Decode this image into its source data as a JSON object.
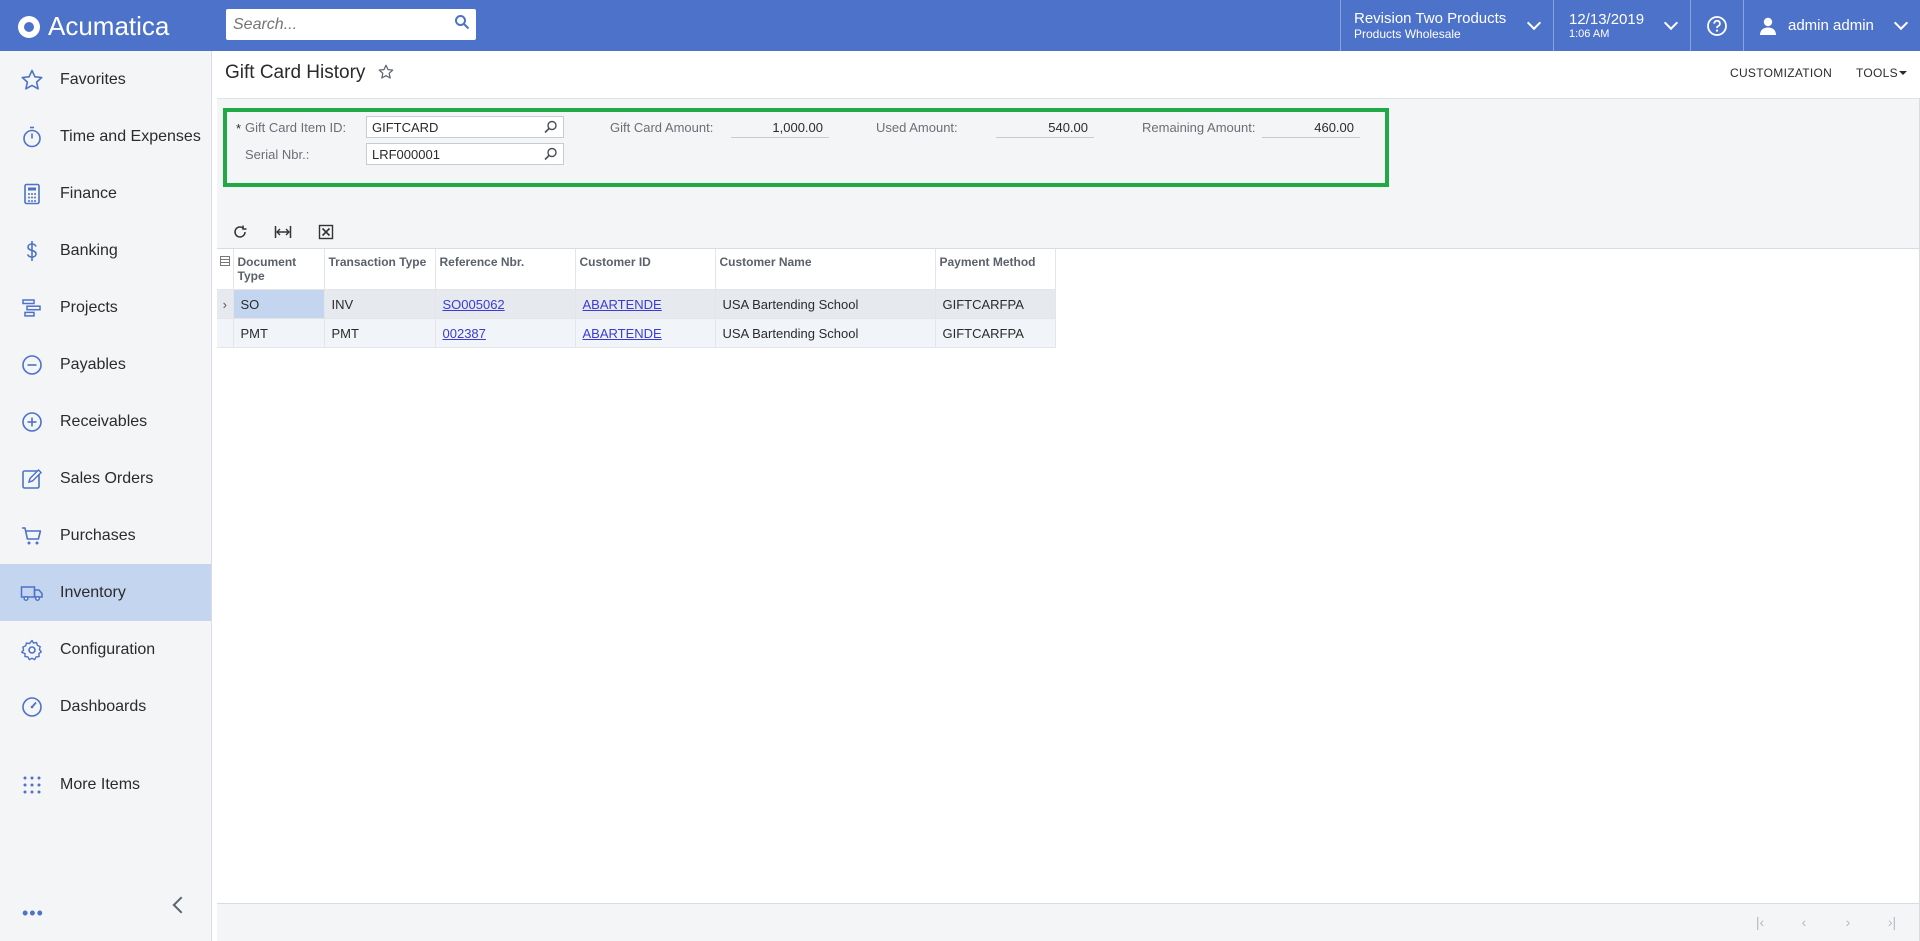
{
  "app": {
    "name": "Acumatica"
  },
  "search": {
    "placeholder": "Search..."
  },
  "header": {
    "company_line1": "Revision Two Products",
    "company_line2": "Products Wholesale",
    "date": "12/13/2019",
    "time": "1:06 AM",
    "user": "admin admin"
  },
  "sidebar": {
    "items": [
      {
        "label": "Favorites",
        "icon": "star-icon"
      },
      {
        "label": "Time and Expenses",
        "icon": "stopwatch-icon"
      },
      {
        "label": "Finance",
        "icon": "calculator-icon"
      },
      {
        "label": "Banking",
        "icon": "dollar-icon"
      },
      {
        "label": "Projects",
        "icon": "projects-icon"
      },
      {
        "label": "Payables",
        "icon": "minus-circle-icon"
      },
      {
        "label": "Receivables",
        "icon": "plus-circle-icon"
      },
      {
        "label": "Sales Orders",
        "icon": "edit-icon"
      },
      {
        "label": "Purchases",
        "icon": "cart-icon"
      },
      {
        "label": "Inventory",
        "icon": "truck-icon"
      },
      {
        "label": "Configuration",
        "icon": "gear-icon"
      },
      {
        "label": "Dashboards",
        "icon": "gauge-icon"
      },
      {
        "label": "More Items",
        "icon": "grid-dots-icon"
      }
    ],
    "active": "Inventory"
  },
  "page": {
    "title": "Gift Card History",
    "customization": "CUSTOMIZATION",
    "tools": "TOOLS"
  },
  "form": {
    "gift_card_item_label": "Gift Card Item ID:",
    "gift_card_item_value": "GIFTCARD",
    "serial_label": "Serial Nbr.:",
    "serial_value": "LRF000001",
    "amount_label": "Gift Card Amount:",
    "amount_value": "1,000.00",
    "used_label": "Used Amount:",
    "used_value": "540.00",
    "remaining_label": "Remaining Amount:",
    "remaining_value": "460.00",
    "required_mark": "*"
  },
  "grid": {
    "headers": {
      "doc_type": "Document Type",
      "txn_type": "Transaction Type",
      "ref_nbr": "Reference Nbr.",
      "cust_id": "Customer ID",
      "cust_name": "Customer Name",
      "pay_method": "Payment Method"
    },
    "rows": [
      {
        "doc_type": "SO",
        "txn_type": "INV",
        "ref_nbr": "SO005062",
        "cust_id": "ABARTENDE",
        "cust_name": "USA Bartending School",
        "pay_method": "GIFTCARFPA"
      },
      {
        "doc_type": "PMT",
        "txn_type": "PMT",
        "ref_nbr": "002387",
        "cust_id": "ABARTENDE",
        "cust_name": "USA Bartending School",
        "pay_method": "GIFTCARFPA"
      }
    ]
  },
  "colors": {
    "accent": "#4d72c9",
    "highlight": "#22a845",
    "active_nav": "#c3d5ef"
  }
}
